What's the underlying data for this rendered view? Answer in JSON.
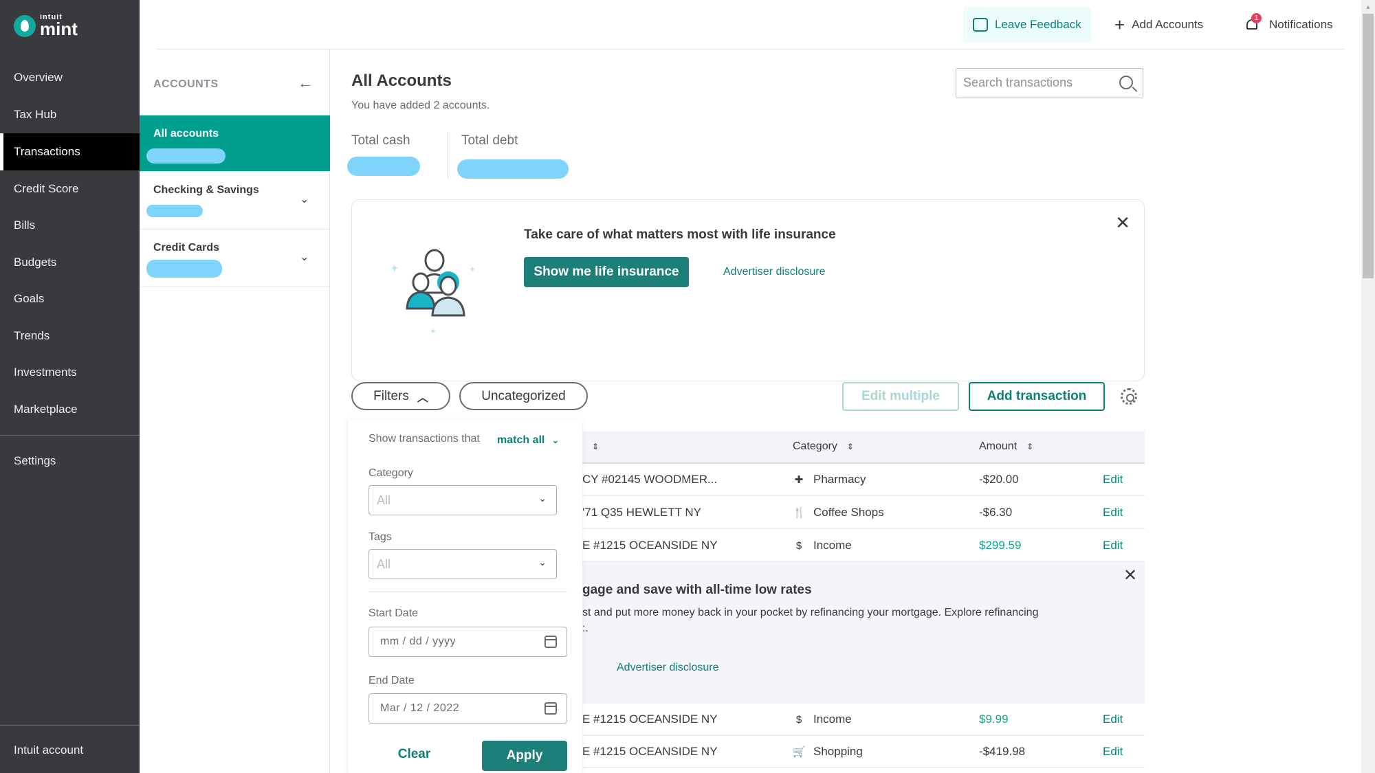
{
  "brand": {
    "top": "intuit",
    "name": "mint"
  },
  "colors": {
    "accent": "#009e8c",
    "button_teal": "#1c7f79",
    "link_teal": "#0d8078",
    "positive_amount": "#0fa38c",
    "nav_bg": "#393a3e",
    "badge_red": "#e4405f"
  },
  "nav": {
    "items": [
      {
        "label": "Overview"
      },
      {
        "label": "Tax Hub"
      },
      {
        "label": "Transactions",
        "active": true
      },
      {
        "label": "Credit Score"
      },
      {
        "label": "Bills"
      },
      {
        "label": "Budgets"
      },
      {
        "label": "Goals"
      },
      {
        "label": "Trends"
      },
      {
        "label": "Investments"
      },
      {
        "label": "Marketplace"
      }
    ],
    "settings": "Settings",
    "account": "Intuit account"
  },
  "header": {
    "feedback": "Leave Feedback",
    "add_accounts": "Add Accounts",
    "notifications": "Notifications",
    "notification_count": "1"
  },
  "accounts_panel": {
    "heading": "ACCOUNTS",
    "back_icon": "arrow-left",
    "groups": [
      {
        "name": "All accounts",
        "selected": true
      },
      {
        "name": "Checking & Savings"
      },
      {
        "name": "Credit Cards"
      }
    ]
  },
  "main": {
    "title": "All Accounts",
    "subtitle": "You have added 2 accounts.",
    "search_placeholder": "Search transactions",
    "total_cash_label": "Total cash",
    "total_debt_label": "Total debt"
  },
  "insurance_ad": {
    "title": "Take care of what matters most with life insurance",
    "button": "Show me life insurance",
    "disclosure": "Advertiser disclosure"
  },
  "toolbar": {
    "filters": "Filters",
    "uncategorized": "Uncategorized",
    "edit_multiple": "Edit multiple",
    "add_transaction": "Add transaction"
  },
  "filter_panel": {
    "show_label": "Show transactions that",
    "match": "match all",
    "category_label": "Category",
    "category_value": "All",
    "tags_label": "Tags",
    "tags_value": "All",
    "start_label": "Start Date",
    "start_value": "mm  /  dd  /  yyyy",
    "end_label": "End Date",
    "end_value": "Mar  /  12  /  2022",
    "clear": "Clear",
    "apply": "Apply"
  },
  "table": {
    "headers": {
      "category": "Category",
      "amount": "Amount"
    },
    "rows_top": [
      {
        "desc": "CY #02145 WOODMER...",
        "category": "Pharmacy",
        "icon": "✚",
        "amount": "-$20.00",
        "positive": false,
        "edit": "Edit"
      },
      {
        "desc": "'71 Q35 HEWLETT NY",
        "category": "Coffee Shops",
        "icon": "🍴",
        "amount": "-$6.30",
        "positive": false,
        "edit": "Edit"
      },
      {
        "desc": "E #1215 OCEANSIDE NY",
        "category": "Income",
        "icon": "$",
        "amount": "$299.59",
        "positive": true,
        "edit": "Edit"
      }
    ],
    "mortgage_ad": {
      "title": "gage and save with all-time low rates",
      "body": "st and put more money back in your pocket by refinancing your mortgage. Explore refinancing",
      "body2": ":.",
      "disclosure": "Advertiser disclosure"
    },
    "rows_bottom": [
      {
        "desc": "E #1215 OCEANSIDE NY",
        "category": "Income",
        "icon": "$",
        "amount": "$9.99",
        "positive": true,
        "edit": "Edit"
      },
      {
        "desc": "E #1215 OCEANSIDE NY",
        "category": "Shopping",
        "icon": "🛒",
        "amount": "-$419.98",
        "positive": false,
        "edit": "Edit"
      }
    ]
  }
}
